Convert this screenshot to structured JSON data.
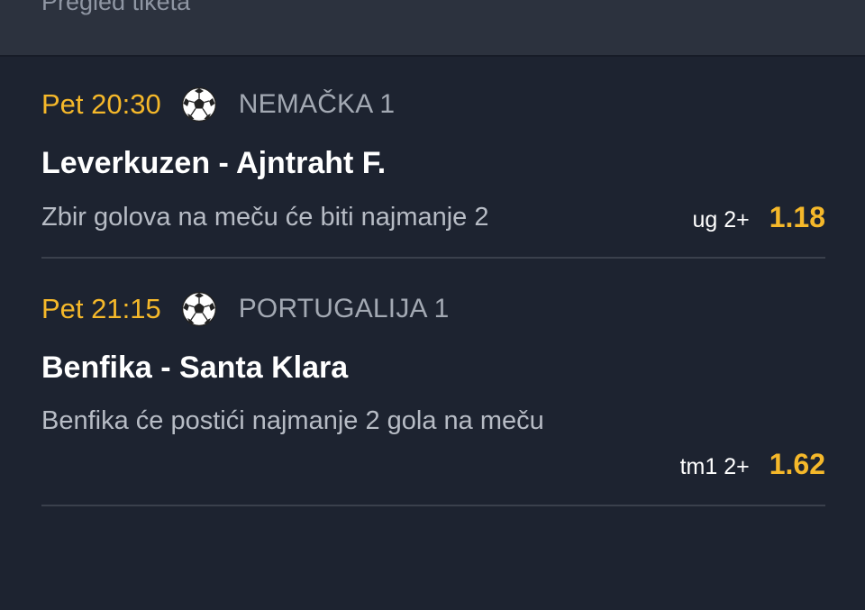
{
  "header": {
    "title": "Pregled tiketa"
  },
  "tickets": [
    {
      "time": "Pet 20:30",
      "sport_icon": "soccer-ball-icon",
      "league": "NEMAČKA 1",
      "match": "Leverkuzen - Ajntraht F.",
      "description": "Zbir golova na meču će biti najmanje 2",
      "pick_code": "ug 2+",
      "odd": "1.18"
    },
    {
      "time": "Pet 21:15",
      "sport_icon": "soccer-ball-icon",
      "league": "PORTUGALIJA 1",
      "match": "Benfika - Santa Klara",
      "description": "Benfika će postići najmanje 2 gola na meču",
      "pick_code": "tm1 2+",
      "odd": "1.62"
    }
  ],
  "colors": {
    "background": "#1d2330",
    "header_background": "#2c323e",
    "accent": "#f5b82a",
    "separator": "#3a404c"
  }
}
